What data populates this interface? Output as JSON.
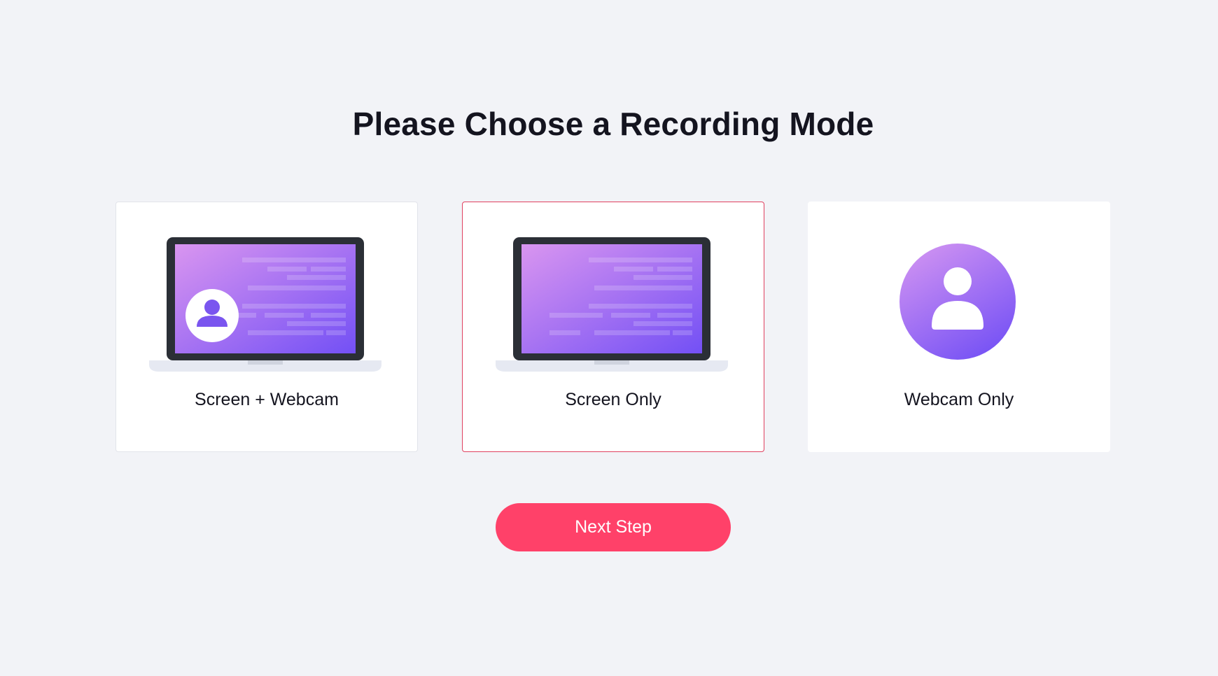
{
  "page": {
    "title": "Please Choose a Recording Mode"
  },
  "modes": [
    {
      "label": "Screen + Webcam",
      "icon": "laptop-with-webcam-icon",
      "selected": false
    },
    {
      "label": "Screen Only",
      "icon": "laptop-screen-icon",
      "selected": true
    },
    {
      "label": "Webcam Only",
      "icon": "webcam-avatar-icon",
      "selected": false
    }
  ],
  "actions": {
    "next_label": "Next Step"
  },
  "colors": {
    "background": "#f2f3f7",
    "accent": "#ff4169",
    "selected_border": "#e0405f",
    "gradient_start": "#d38ef0",
    "gradient_end": "#7350f5",
    "laptop_frame": "#2b2f36"
  }
}
